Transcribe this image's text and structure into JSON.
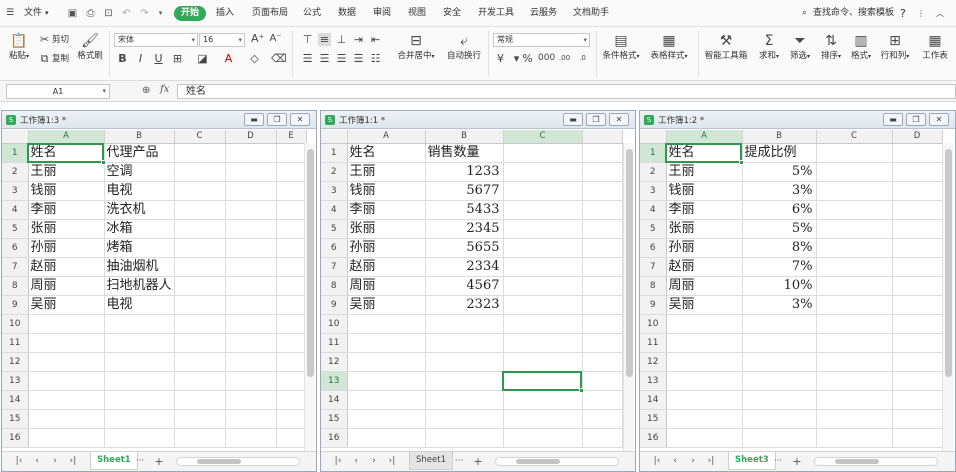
{
  "menubar": {
    "file_label": "文件",
    "tabs": [
      "开始",
      "插入",
      "页面布局",
      "公式",
      "数据",
      "审阅",
      "视图",
      "安全",
      "开发工具",
      "云服务",
      "文档助手"
    ],
    "search_label": "查找命令、搜索模板",
    "help_label": "?"
  },
  "ribbon": {
    "paste": "粘贴",
    "cut": "剪切",
    "copy": "复制",
    "format_painter": "格式刷",
    "font_name": "宋体",
    "font_size": "16",
    "merge_center": "合并居中",
    "wrap_text": "自动换行",
    "number_format": "常规",
    "conditional_format": "条件格式",
    "table_style": "表格样式",
    "smart_toolbox": "智能工具箱",
    "sum": "求和",
    "filter": "筛选",
    "sort": "排序",
    "format": "格式",
    "rows_cols": "行和列",
    "worksheet": "工作表"
  },
  "formulabar": {
    "name_box": "A1",
    "fx": "fx",
    "formula": "姓名"
  },
  "workbooks": [
    {
      "title": "工作簿1:3 *",
      "columns": [
        "A",
        "B",
        "C",
        "D",
        "E"
      ],
      "rows": [
        [
          "1",
          "姓名",
          "代理产品",
          "",
          "",
          ""
        ],
        [
          "2",
          "王丽",
          "空调",
          "",
          "",
          ""
        ],
        [
          "3",
          "钱丽",
          "电视",
          "",
          "",
          ""
        ],
        [
          "4",
          "李丽",
          "洗衣机",
          "",
          "",
          ""
        ],
        [
          "5",
          "张丽",
          "冰箱",
          "",
          "",
          ""
        ],
        [
          "6",
          "孙丽",
          "烤箱",
          "",
          "",
          ""
        ],
        [
          "7",
          "赵丽",
          "抽油烟机",
          "",
          "",
          ""
        ],
        [
          "8",
          "周丽",
          "扫地机器人",
          "",
          "",
          ""
        ],
        [
          "9",
          "吴丽",
          "电视",
          "",
          "",
          ""
        ],
        [
          "10",
          "",
          "",
          "",
          "",
          ""
        ],
        [
          "11",
          "",
          "",
          "",
          "",
          ""
        ],
        [
          "12",
          "",
          "",
          "",
          "",
          ""
        ],
        [
          "13",
          "",
          "",
          "",
          "",
          ""
        ],
        [
          "14",
          "",
          "",
          "",
          "",
          ""
        ],
        [
          "15",
          "",
          "",
          "",
          "",
          ""
        ],
        [
          "16",
          "",
          "",
          "",
          "",
          ""
        ]
      ],
      "sheet_tab": "Sheet1"
    },
    {
      "title": "工作簿1:1 *",
      "columns": [
        "A",
        "B",
        "C",
        ""
      ],
      "rows": [
        [
          "1",
          "姓名",
          "销售数量",
          "",
          ""
        ],
        [
          "2",
          "王丽",
          "1233",
          "",
          ""
        ],
        [
          "3",
          "钱丽",
          "5677",
          "",
          ""
        ],
        [
          "4",
          "李丽",
          "5433",
          "",
          ""
        ],
        [
          "5",
          "张丽",
          "2345",
          "",
          ""
        ],
        [
          "6",
          "孙丽",
          "5655",
          "",
          ""
        ],
        [
          "7",
          "赵丽",
          "2334",
          "",
          ""
        ],
        [
          "8",
          "周丽",
          "4567",
          "",
          ""
        ],
        [
          "9",
          "吴丽",
          "2323",
          "",
          ""
        ],
        [
          "10",
          "",
          "",
          "",
          ""
        ],
        [
          "11",
          "",
          "",
          "",
          ""
        ],
        [
          "12",
          "",
          "",
          "",
          ""
        ],
        [
          "13",
          "",
          "",
          "",
          ""
        ],
        [
          "14",
          "",
          "",
          "",
          ""
        ],
        [
          "15",
          "",
          "",
          "",
          ""
        ],
        [
          "16",
          "",
          "",
          "",
          ""
        ]
      ],
      "sheet_tab": "Sheet1"
    },
    {
      "title": "工作簿1:2 *",
      "columns": [
        "A",
        "B",
        "C",
        "D"
      ],
      "rows": [
        [
          "1",
          "姓名",
          "提成比例",
          "",
          ""
        ],
        [
          "2",
          "王丽",
          "5%",
          "",
          ""
        ],
        [
          "3",
          "钱丽",
          "3%",
          "",
          ""
        ],
        [
          "4",
          "李丽",
          "6%",
          "",
          ""
        ],
        [
          "5",
          "张丽",
          "5%",
          "",
          ""
        ],
        [
          "6",
          "孙丽",
          "8%",
          "",
          ""
        ],
        [
          "7",
          "赵丽",
          "7%",
          "",
          ""
        ],
        [
          "8",
          "周丽",
          "10%",
          "",
          ""
        ],
        [
          "9",
          "吴丽",
          "3%",
          "",
          ""
        ],
        [
          "10",
          "",
          "",
          "",
          ""
        ],
        [
          "11",
          "",
          "",
          "",
          ""
        ],
        [
          "12",
          "",
          "",
          "",
          ""
        ],
        [
          "13",
          "",
          "",
          "",
          ""
        ],
        [
          "14",
          "",
          "",
          "",
          ""
        ],
        [
          "15",
          "",
          "",
          "",
          ""
        ],
        [
          "16",
          "",
          "",
          "",
          ""
        ]
      ],
      "sheet_tab": "Sheet3"
    }
  ],
  "colors": {
    "accent": "#2eaa58",
    "selection": "#2c9a4d"
  }
}
